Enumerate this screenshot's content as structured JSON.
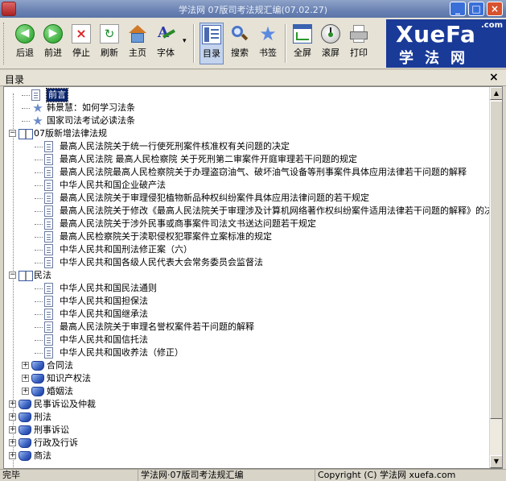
{
  "window": {
    "title": "学法网 07版司考法规汇编(07.02.27)",
    "min_glyph": "_",
    "max_glyph": "□",
    "close_glyph": "×"
  },
  "toolbar": {
    "back": "后退",
    "forward": "前进",
    "stop": "停止",
    "refresh": "刷新",
    "home": "主页",
    "font": "字体",
    "toc": "目录",
    "search": "搜索",
    "bookmark": "书签",
    "fullscreen": "全屏",
    "autoscroll": "滚屏",
    "print": "打印",
    "font_menu_glyph": "▾"
  },
  "logo": {
    "en": "XueFa",
    "com": ".com",
    "cn": "学法网"
  },
  "panel": {
    "title": "目录",
    "close_glyph": "×"
  },
  "tree": [
    {
      "level": 1,
      "icon": "doc",
      "label": "前言",
      "selected": true
    },
    {
      "level": 1,
      "icon": "star",
      "label": "韩景慧：如何学习法条"
    },
    {
      "level": 1,
      "icon": "star",
      "label": "国家司法考试必读法条"
    },
    {
      "level": 0,
      "icon": "book",
      "label": "07版新增法律法规",
      "expander": "−"
    },
    {
      "level": 2,
      "icon": "doc",
      "label": "最高人民法院关于统一行使死刑案件核准权有关问题的决定"
    },
    {
      "level": 2,
      "icon": "doc",
      "label": "最高人民法院 最高人民检察院 关于死刑第二审案件开庭审理若干问题的规定"
    },
    {
      "level": 2,
      "icon": "doc",
      "label": "最高人民法院最高人民检察院关于办理盗窃油气、破坏油气设备等刑事案件具体应用法律若干问题的解释"
    },
    {
      "level": 2,
      "icon": "doc",
      "label": "中华人民共和国企业破产法"
    },
    {
      "level": 2,
      "icon": "doc",
      "label": "最高人民法院关于审理侵犯植物新品种权纠纷案件具体应用法律问题的若干规定"
    },
    {
      "level": 2,
      "icon": "doc",
      "label": "最高人民法院关于修改《最高人民法院关于审理涉及计算机网络著作权纠纷案件适用法律若干问题的解释》的决定"
    },
    {
      "level": 2,
      "icon": "doc",
      "label": "最高人民法院关于涉外民事或商事案件司法文书送达问题若干规定"
    },
    {
      "level": 2,
      "icon": "doc",
      "label": "最高人民检察院关于渎职侵权犯罪案件立案标准的规定"
    },
    {
      "level": 2,
      "icon": "doc",
      "label": "中华人民共和国刑法修正案（六）"
    },
    {
      "level": 2,
      "icon": "doc",
      "label": "中华人民共和国各级人民代表大会常务委员会监督法"
    },
    {
      "level": 0,
      "icon": "book",
      "label": "民法",
      "expander": "−"
    },
    {
      "level": 2,
      "icon": "doc",
      "label": "中华人民共和国民法通则"
    },
    {
      "level": 2,
      "icon": "doc",
      "label": "中华人民共和国担保法"
    },
    {
      "level": 2,
      "icon": "doc",
      "label": "中华人民共和国继承法"
    },
    {
      "level": 2,
      "icon": "doc",
      "label": "最高人民法院关于审理名誉权案件若干问题的解释"
    },
    {
      "level": 2,
      "icon": "doc",
      "label": "中华人民共和国信托法"
    },
    {
      "level": 2,
      "icon": "doc",
      "label": "中华人民共和国收养法（修正）"
    },
    {
      "level": 1,
      "icon": "gem",
      "label": "合同法",
      "expander": "+"
    },
    {
      "level": 1,
      "icon": "gem",
      "label": "知识产权法",
      "expander": "+"
    },
    {
      "level": 1,
      "icon": "gem",
      "label": "婚姻法",
      "expander": "+"
    },
    {
      "level": 0,
      "icon": "gem",
      "label": "民事诉讼及仲裁",
      "expander": "+"
    },
    {
      "level": 0,
      "icon": "gem",
      "label": "刑法",
      "expander": "+"
    },
    {
      "level": 0,
      "icon": "gem",
      "label": "刑事诉讼",
      "expander": "+"
    },
    {
      "level": 0,
      "icon": "gem",
      "label": "行政及行诉",
      "expander": "+"
    },
    {
      "level": 0,
      "icon": "gem",
      "label": "商法",
      "expander": "+"
    }
  ],
  "scrollbar": {
    "up_glyph": "▲",
    "down_glyph": "▼"
  },
  "status": {
    "state": "完毕",
    "app": "学法网·07版司考法规汇编",
    "copyright": "Copyright (C) 学法网 xuefa.com"
  }
}
